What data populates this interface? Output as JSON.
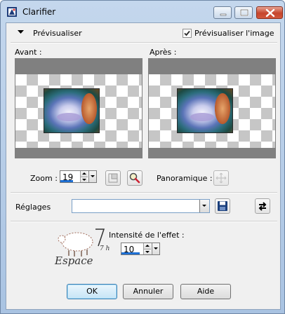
{
  "window": {
    "title": "Clarifier"
  },
  "header": {
    "collapse_label": "Prévisualiser",
    "preview_checkbox_label": "Prévisualiser l'image",
    "preview_checked": true
  },
  "preview": {
    "before_label": "Avant :",
    "after_label": "Après :"
  },
  "zoom": {
    "label": "Zoom :",
    "value": "19",
    "pan_label": "Panoramique :"
  },
  "settings": {
    "label": "Réglages",
    "value": ""
  },
  "effect": {
    "intensity_label": "Intensité de l'effet :",
    "intensity_value": "10"
  },
  "watermark": {
    "text": "Espace",
    "side_letters": "7 h"
  },
  "buttons": {
    "ok": "OK",
    "cancel": "Annuler",
    "help": "Aide"
  },
  "colors": {
    "accent": "#1e6fd3",
    "close_button": "#c6452d",
    "titlebar": "#b9cfe8"
  }
}
